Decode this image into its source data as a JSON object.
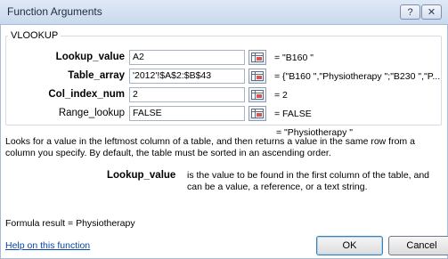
{
  "window": {
    "title": "Function Arguments",
    "help_button_label": "?",
    "close_button_label": "✕"
  },
  "function_name": "VLOOKUP",
  "arguments": [
    {
      "label": "Lookup_value",
      "bold": true,
      "value": "A2",
      "result": "=  \"B160 \""
    },
    {
      "label": "Table_array",
      "bold": true,
      "value": "'2012'!$A$2:$B$43",
      "result": "=  {\"B160 \",\"Physiotherapy \";\"B230 \",\"P..."
    },
    {
      "label": "Col_index_num",
      "bold": true,
      "value": "2",
      "result": "=  2"
    },
    {
      "label": "Range_lookup",
      "bold": false,
      "value": "FALSE",
      "result": "=  FALSE"
    }
  ],
  "function_result": "=  \"Physiotherapy \"",
  "description": "Looks for a value in the leftmost column of a table, and then returns a value in the same row from a column you specify. By default, the table must be sorted in an ascending order.",
  "arg_help": {
    "label": "Lookup_value",
    "text": "is the value to be found in the first column of the table, and can be a value, a reference, or a text string."
  },
  "formula_result": "Formula result =  Physiotherapy",
  "help_link": "Help on this function",
  "buttons": {
    "ok": "OK",
    "cancel": "Cancel"
  }
}
